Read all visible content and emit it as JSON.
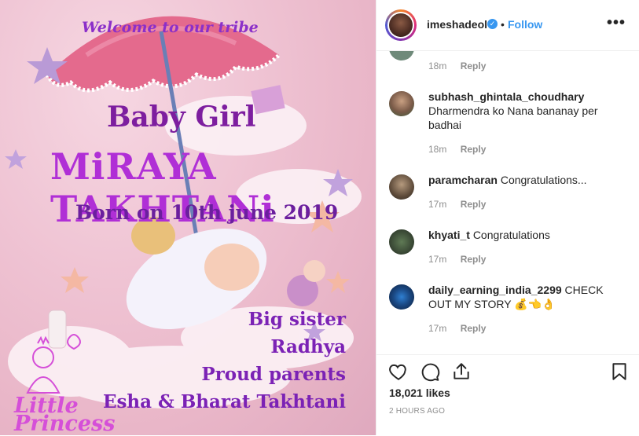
{
  "post_image": {
    "welcome": "Welcome to our tribe",
    "subtitle": "Baby Girl",
    "name": "MiRAYA TAKHTANi",
    "born": "Born on 10th june 2019",
    "lines": [
      "Big sister",
      "Radhya",
      "Proud parents",
      "Esha & Bharat Takhtani"
    ],
    "corner": [
      "Little",
      "Princess"
    ],
    "colors": {
      "purple": "#8b2fc9",
      "pink_bg": "#efc3d3"
    }
  },
  "header": {
    "username": "imeshadeol",
    "verified_icon": "verified-badge-icon",
    "separator": "•",
    "follow_label": "Follow",
    "more_label": "•••"
  },
  "comments": [
    {
      "username": "",
      "text": "",
      "time": "18m",
      "reply": "Reply"
    },
    {
      "username": "subhash_ghintala_choudhary",
      "text": "Dharmendra ko Nana bananay per badhai",
      "time": "18m",
      "reply": "Reply"
    },
    {
      "username": "paramcharan",
      "text": "Congratulations...",
      "time": "17m",
      "reply": "Reply"
    },
    {
      "username": "khyati_t",
      "text": "Congratulations",
      "time": "17m",
      "reply": "Reply"
    },
    {
      "username": "daily_earning_india_2299",
      "text": "CHECK OUT MY STORY 💰👈👌",
      "time": "17m",
      "reply": "Reply"
    }
  ],
  "footer": {
    "likes": "18,021 likes",
    "posted": "2 HOURS AGO"
  },
  "colors": {
    "link": "#3897f0",
    "muted": "#8e8e8e",
    "text": "#262626"
  }
}
